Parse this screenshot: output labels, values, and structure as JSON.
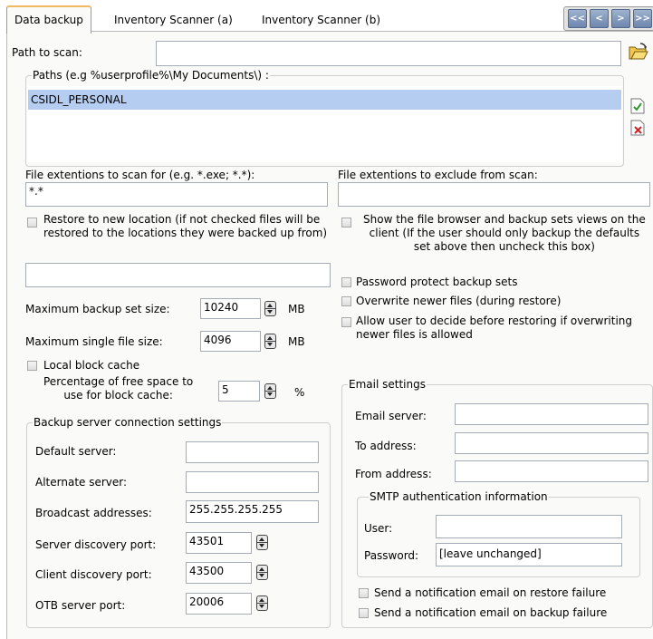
{
  "tabs": [
    {
      "label": "Data backup"
    },
    {
      "label": "Inventory Scanner (a)"
    },
    {
      "label": "Inventory Scanner (b)"
    }
  ],
  "nav": {
    "first": "<<",
    "prev": "<",
    "next": ">",
    "last": ">>"
  },
  "scan": {
    "path_label": "Path to scan:",
    "path_value": "",
    "paths_legend": "Paths (e.g %userprofile%\\My Documents\\) :",
    "paths": [
      "CSIDL_PERSONAL"
    ],
    "ext_include_label": "File extentions to scan for (e.g. *.exe; *.*):",
    "ext_include_value": "*.*",
    "ext_exclude_label": "File extentions to exclude from scan:",
    "ext_exclude_value": ""
  },
  "options": {
    "restore_new_location": "Restore to new location (if not checked files will be\nrestored to the locations they were backed up from)",
    "restore_location_value": "",
    "show_file_browser": "Show the file browser and backup sets views on the\nclient (If the user should only backup the defaults\nset above then uncheck this box)",
    "password_protect": "Password protect backup sets",
    "overwrite_newer": "Overwrite newer files (during restore)",
    "allow_user_decide": "Allow user to decide before restoring if overwriting\nnewer files is allowed",
    "local_block_cache": "Local block cache"
  },
  "sizes": {
    "max_backup_label": "Maximum backup set size:",
    "max_backup_value": "10240",
    "max_backup_unit": "MB",
    "max_file_label": "Maximum single file size:",
    "max_file_value": "4096",
    "max_file_unit": "MB",
    "free_space_label": "Percentage of free space to\nuse for block cache:",
    "free_space_value": "5",
    "free_space_unit": "%"
  },
  "server": {
    "legend": "Backup server connection settings",
    "default_label": "Default server:",
    "default_value": "",
    "alternate_label": "Alternate server:",
    "alternate_value": "",
    "broadcast_label": "Broadcast addresses:",
    "broadcast_value": "255.255.255.255",
    "server_port_label": "Server discovery port:",
    "server_port_value": "43501",
    "client_port_label": "Client discovery port:",
    "client_port_value": "43500",
    "otb_port_label": "OTB server port:",
    "otb_port_value": "20006"
  },
  "email": {
    "legend": "Email settings",
    "server_label": "Email server:",
    "server_value": "",
    "to_label": "To address:",
    "to_value": "",
    "from_label": "From address:",
    "from_value": "",
    "smtp_legend": "SMTP authentication information",
    "user_label": "User:",
    "user_value": "",
    "password_label": "Password:",
    "password_value": "[leave unchanged]",
    "notify_restore": "Send a notification email on restore failure",
    "notify_backup": "Send a notification email on backup failure"
  }
}
